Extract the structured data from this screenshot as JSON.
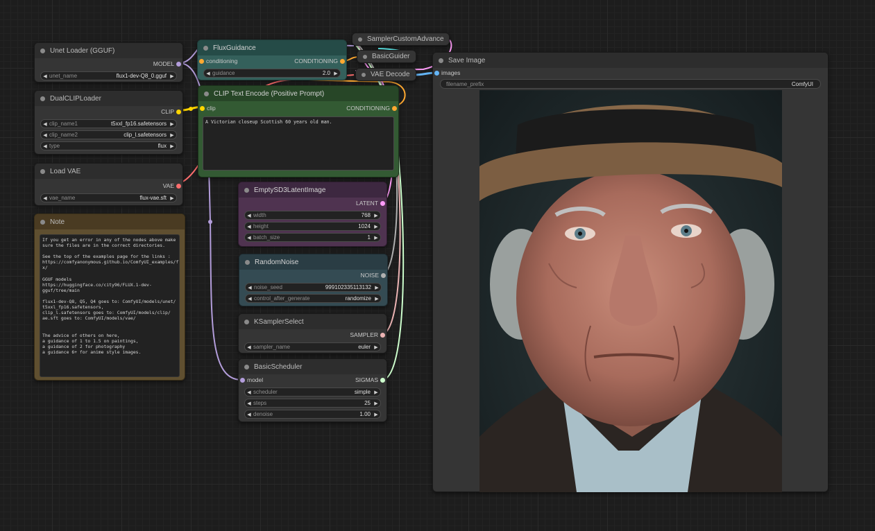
{
  "colors": {
    "model": "#b39ddb",
    "clip": "#ffd500",
    "vae": "#ff6e6e",
    "conditioning": "#ffa931",
    "latent": "#ff9cf9",
    "noise": "#b0b0b0",
    "sampler": "#ecb4b4",
    "sigmas": "#cdffcd",
    "image": "#64b5f6",
    "guider": "#66ffff"
  },
  "nodes": {
    "unet_loader": {
      "title": "Unet Loader (GGUF)",
      "output": "MODEL",
      "widgets": [
        {
          "name": "unet_name",
          "value": "flux1-dev-Q8_0.gguf"
        }
      ]
    },
    "dual_clip": {
      "title": "DualCLIPLoader",
      "output": "CLIP",
      "widgets": [
        {
          "name": "clip_name1",
          "value": "t5xxl_fp16.safetensors"
        },
        {
          "name": "clip_name2",
          "value": "clip_l.safetensors"
        },
        {
          "name": "type",
          "value": "flux"
        }
      ]
    },
    "load_vae": {
      "title": "Load VAE",
      "output": "VAE",
      "widgets": [
        {
          "name": "vae_name",
          "value": "flux-vae.sft"
        }
      ]
    },
    "note": {
      "title": "Note",
      "text": "If you get an error in any of the nodes above make\nsure the files are in the correct directories.\n\nSee the top of the examples page for the links :\nhttps://comfyanonymous.github.io/ComfyUI_examples/flu\nx/\n\nGGUF models\nhttps://huggingface.co/city96/FLUX.1-dev-\ngguf/tree/main\n\nflux1-dev-Q8, Q5, Q4 goes to: ComfyUI/models/unet/\nt5xxl_fp16.safetensors,\nclip_l.safetensors goes to: ComfyUI/models/clip/\nae.sft goes to: ComfyUI/models/vae/\n\n\nThe advice of others on here,\na guidance of 1 to 1.5 on paintings,\na guidance of 2 for photography\na guidance 6+ for anime style images."
    },
    "flux_guidance": {
      "title": "FluxGuidance",
      "input": "conditioning",
      "output": "CONDITIONING",
      "widgets": [
        {
          "name": "guidance",
          "value": "2.0"
        }
      ]
    },
    "clip_text_encode": {
      "title": "CLIP Text Encode (Positive Prompt)",
      "input": "clip",
      "output": "CONDITIONING",
      "prompt": "A Victorian closeup Scottish 60 years old man."
    },
    "sampler_custom_advanced": {
      "title": "SamplerCustomAdvance"
    },
    "basic_guider": {
      "title": "BasicGuider"
    },
    "vae_decode": {
      "title": "VAE Decode"
    },
    "save_image": {
      "title": "Save Image",
      "input": "images",
      "widgets": [
        {
          "name": "filename_prefix",
          "value": "ComfyUI"
        }
      ]
    },
    "empty_latent": {
      "title": "EmptySD3LatentImage",
      "output": "LATENT",
      "widgets": [
        {
          "name": "width",
          "value": "768"
        },
        {
          "name": "height",
          "value": "1024"
        },
        {
          "name": "batch_size",
          "value": "1"
        }
      ]
    },
    "random_noise": {
      "title": "RandomNoise",
      "output": "NOISE",
      "widgets": [
        {
          "name": "noise_seed",
          "value": "999102335113132"
        },
        {
          "name": "control_after_generate",
          "value": "randomize"
        }
      ]
    },
    "ksampler_select": {
      "title": "KSamplerSelect",
      "output": "SAMPLER",
      "widgets": [
        {
          "name": "sampler_name",
          "value": "euler"
        }
      ]
    },
    "basic_scheduler": {
      "title": "BasicScheduler",
      "input": "model",
      "output": "SIGMAS",
      "widgets": [
        {
          "name": "scheduler",
          "value": "simple"
        },
        {
          "name": "steps",
          "value": "25"
        },
        {
          "name": "denoise",
          "value": "1.00"
        }
      ]
    }
  }
}
